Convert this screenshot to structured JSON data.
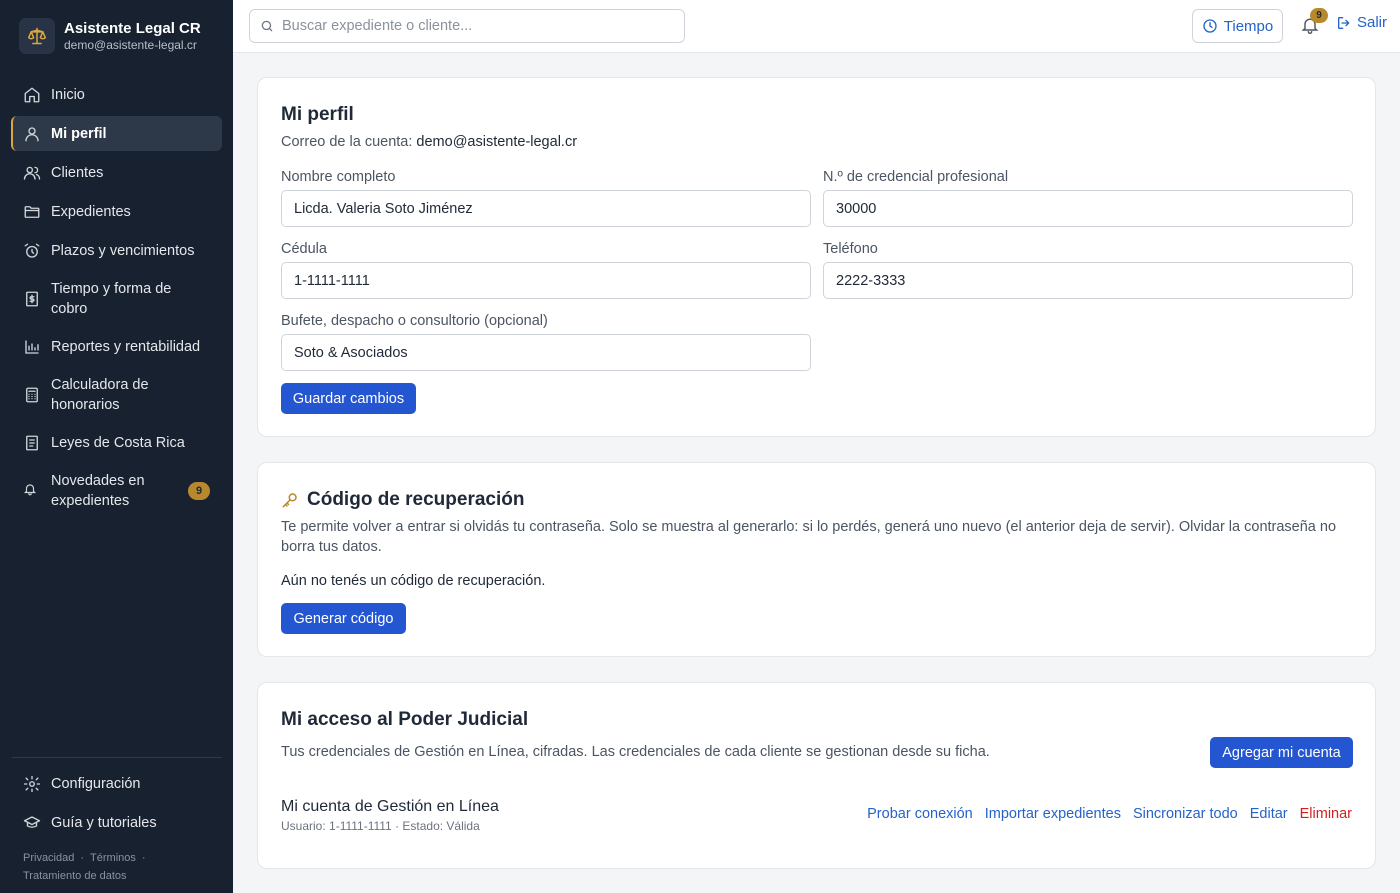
{
  "brand": {
    "title": "Asistente Legal CR",
    "email": "demo@asistente-legal.cr"
  },
  "sidebar": {
    "items": [
      {
        "label": "Inicio"
      },
      {
        "label": "Mi perfil"
      },
      {
        "label": "Clientes"
      },
      {
        "label": "Expedientes"
      },
      {
        "label": "Plazos y vencimientos"
      },
      {
        "label": "Tiempo y forma de cobro"
      },
      {
        "label": "Reportes y rentabilidad"
      },
      {
        "label": "Calculadora de honorarios"
      },
      {
        "label": "Leyes de Costa Rica"
      },
      {
        "label": "Novedades en expedientes",
        "badge": "9"
      }
    ],
    "bottom": [
      {
        "label": "Configuración"
      },
      {
        "label": "Guía y tutoriales"
      }
    ],
    "legal": {
      "privacy": "Privacidad",
      "terms": "Términos",
      "data": "Tratamiento de datos"
    }
  },
  "topbar": {
    "search_placeholder": "Buscar expediente o cliente...",
    "tiempo_label": "Tiempo",
    "notifications_count": "9",
    "logout_label": "Salir"
  },
  "profile": {
    "title": "Mi perfil",
    "account_email_label": "Correo de la cuenta:",
    "account_email": "demo@asistente-legal.cr",
    "fields": {
      "full_name": {
        "label": "Nombre completo",
        "value": "Licda. Valeria Soto Jiménez"
      },
      "credential": {
        "label": "N.º de credencial profesional",
        "value": "30000"
      },
      "cedula": {
        "label": "Cédula",
        "value": "1-1111-1111"
      },
      "phone": {
        "label": "Teléfono",
        "value": "2222-3333"
      },
      "firm": {
        "label": "Bufete, despacho o consultorio (opcional)",
        "value": "Soto & Asociados"
      }
    },
    "save_label": "Guardar cambios"
  },
  "recovery": {
    "title": "Código de recuperación",
    "description": "Te permite volver a entrar si olvidás tu contraseña. Solo se muestra al generarlo: si lo perdés, generá uno nuevo (el anterior deja de servir). Olvidar la contraseña no borra tus datos.",
    "status": "Aún no tenés un código de recuperación.",
    "generate_label": "Generar código"
  },
  "judicial": {
    "title": "Mi acceso al Poder Judicial",
    "description": "Tus credenciales de Gestión en Línea, cifradas. Las credenciales de cada cliente se gestionan desde su ficha.",
    "add_label": "Agregar mi cuenta",
    "account": {
      "name": "Mi cuenta de Gestión en Línea",
      "details": "Usuario: 1-1111-1111 · Estado: Válida",
      "actions": {
        "test": "Probar conexión",
        "import": "Importar expedientes",
        "sync": "Sincronizar todo",
        "edit": "Editar",
        "delete": "Eliminar"
      }
    }
  },
  "colors": {
    "sidebar_bg": "#17212f",
    "primary": "#2456d2",
    "link": "#2563c9",
    "danger": "#d31f1f",
    "badge": "#b8892c"
  }
}
